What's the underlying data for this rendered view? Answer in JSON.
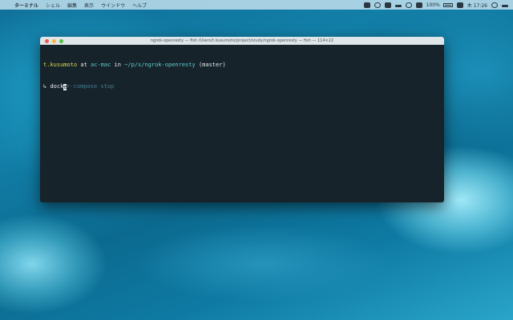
{
  "menubar": {
    "app_name": "ターミナル",
    "items": [
      "シェル",
      "編集",
      "表示",
      "ウインドウ",
      "ヘルプ"
    ],
    "battery": "100%",
    "clock": "木 17:26"
  },
  "terminal": {
    "title": "ngrok-openresty — fish /Users/t.kusumoto/project/study/ngrok-openresty — fish — 114×22",
    "prompt": {
      "user": "t.kusumoto",
      "at": "at",
      "host": "ac-mac",
      "in": "in",
      "path": "~/p/s/ngrok-openresty",
      "branch": "(master)"
    },
    "input": {
      "arrow": "↳",
      "typed": "dock",
      "under_cursor": "e",
      "suggestion": "r-compose stop"
    }
  }
}
